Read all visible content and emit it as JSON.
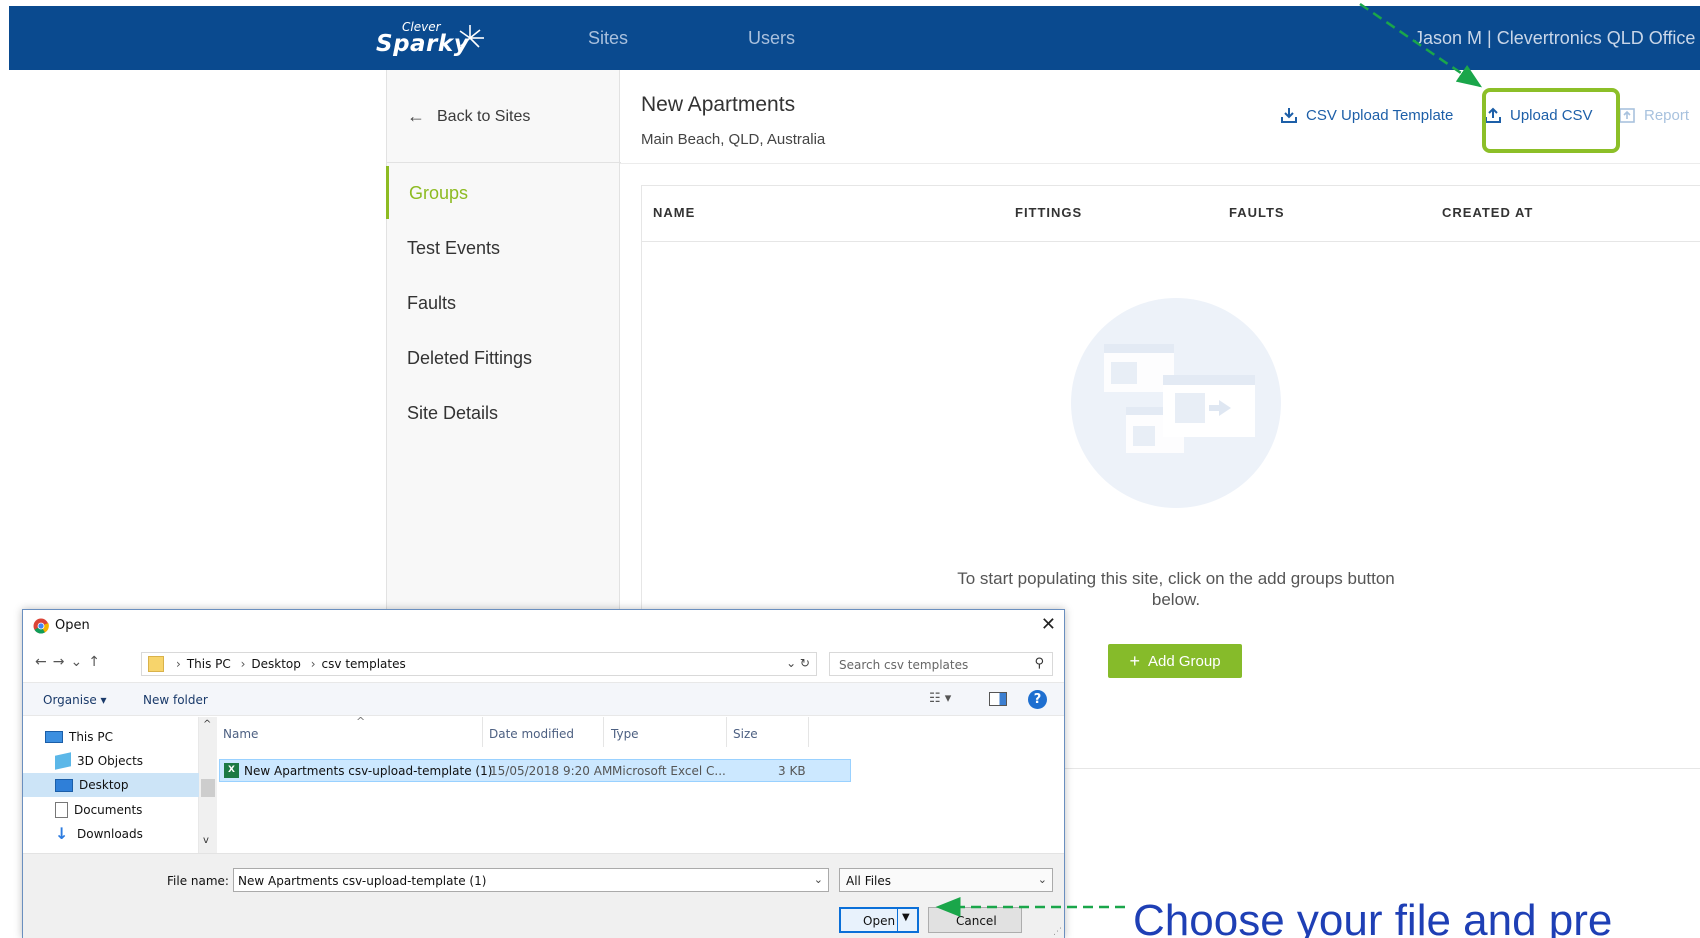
{
  "topnav": {
    "logo_top": "Clever",
    "logo_main": "Sparky",
    "links": [
      "Sites",
      "Users"
    ],
    "user": "Jason M | Clevertronics QLD Office"
  },
  "sidebar": {
    "back": "Back to Sites",
    "items": [
      "Groups",
      "Test Events",
      "Faults",
      "Deleted Fittings",
      "Site Details"
    ],
    "active_item": "Groups"
  },
  "site": {
    "title": "New Apartments",
    "address": "Main Beach, QLD, Australia"
  },
  "actions": {
    "csv_template": "CSV Upload Template",
    "upload_csv": "Upload CSV",
    "report": "Report"
  },
  "table": {
    "columns": [
      "NAME",
      "FITTINGS",
      "FAULTS",
      "CREATED AT"
    ],
    "empty_message": "To start populating this site, click on the add groups button below.",
    "add_group": "Add Group"
  },
  "dialog": {
    "title": "Open",
    "breadcrumb": [
      "This PC",
      "Desktop",
      "csv templates"
    ],
    "search_placeholder": "Search csv templates",
    "organise": "Organise ▾",
    "new_folder": "New folder",
    "nav_items": [
      "This PC",
      "3D Objects",
      "Desktop",
      "Documents",
      "Downloads"
    ],
    "selected_nav": "Desktop",
    "columns": [
      "Name",
      "Date modified",
      "Type",
      "Size"
    ],
    "files": [
      {
        "name": "New Apartments csv-upload-template (1)",
        "date": "15/05/2018 9:20 AM",
        "type": "Microsoft Excel C...",
        "size": "3 KB"
      }
    ],
    "file_name_label": "File name:",
    "file_name_value": "New Apartments csv-upload-template (1)",
    "file_type": "All Files",
    "open": "Open",
    "cancel": "Cancel"
  },
  "annotation": {
    "callout": "Choose your file and pre"
  },
  "colors": {
    "nav_bg": "#0a4a8f",
    "accent_green": "#8dbb22",
    "link_blue": "#1d5fa8",
    "arrow_green": "#1aa64a",
    "callout_blue": "#1e3fb5"
  }
}
